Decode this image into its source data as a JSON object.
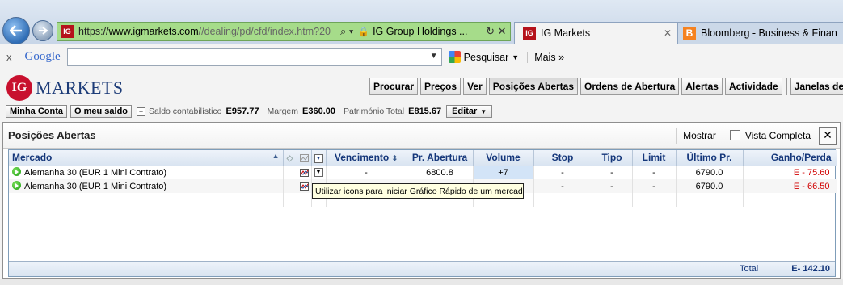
{
  "browser": {
    "address": {
      "scheme": "https://",
      "host": "www.igmarkets.com",
      "path": "//dealing/pd/cfd/index.htm?20",
      "cert_label": "IG Group Holdings ..."
    },
    "tabs": [
      {
        "label": "IG Markets",
        "favicon": "IG"
      },
      {
        "label": "Bloomberg - Business & Finan...",
        "favicon": "B"
      }
    ],
    "toolbar": {
      "close_glyph": "x",
      "google_label": "Google",
      "search_label": "Pesquisar",
      "more_label": "Mais"
    }
  },
  "ig": {
    "logo_circle": "IG",
    "logo_word": "MARKETS",
    "nav": [
      "Procurar",
      "Preços",
      "Ver",
      "Posições Abertas",
      "Ordens de Abertura",
      "Alertas",
      "Actividade"
    ],
    "nav_extra": "Janelas de Operaç",
    "account": {
      "minha_conta": "Minha Conta",
      "meu_saldo": "O meu saldo",
      "saldo_label": "Saldo contabilístico",
      "saldo_value": "E957.77",
      "margem_label": "Margem",
      "margem_value": "E360.00",
      "patrimonio_label": "Património Total",
      "patrimonio_value": "E815.67",
      "editar": "Editar"
    }
  },
  "panel": {
    "title": "Posições Abertas",
    "mostrar": "Mostrar",
    "vista": "Vista Completa",
    "columns": {
      "mercado": "Mercado",
      "vencimento": "Vencimento",
      "abertura": "Pr. Abertura",
      "volume": "Volume",
      "stop": "Stop",
      "tipo": "Tipo",
      "limit": "Limit",
      "ultimo": "Último Pr.",
      "ganho": "Ganho/Perda"
    },
    "rows": [
      {
        "mercado": "Alemanha 30 (EUR 1 Mini Contrato)",
        "vencimento": "-",
        "abertura": "6800.8",
        "volume": "+7",
        "stop": "-",
        "tipo": "-",
        "limit": "-",
        "ultimo": "6790.0",
        "ganho": "E - 75.60"
      },
      {
        "mercado": "Alemanha 30 (EUR 1 Mini Contrato)",
        "vencimento": "",
        "abertura": "",
        "volume": "",
        "stop": "-",
        "tipo": "-",
        "limit": "-",
        "ultimo": "6790.0",
        "ganho": "E - 66.50"
      }
    ],
    "total_label": "Total",
    "total_value": "E- 142.10",
    "tooltip": "Utilizar icons para iniciar Gráfico Rápido de um mercado"
  },
  "colors": {
    "ig_red": "#c8102e",
    "ig_blue": "#1d3c78",
    "loss_red": "#d10000",
    "address_green": "#a6dc8a"
  }
}
